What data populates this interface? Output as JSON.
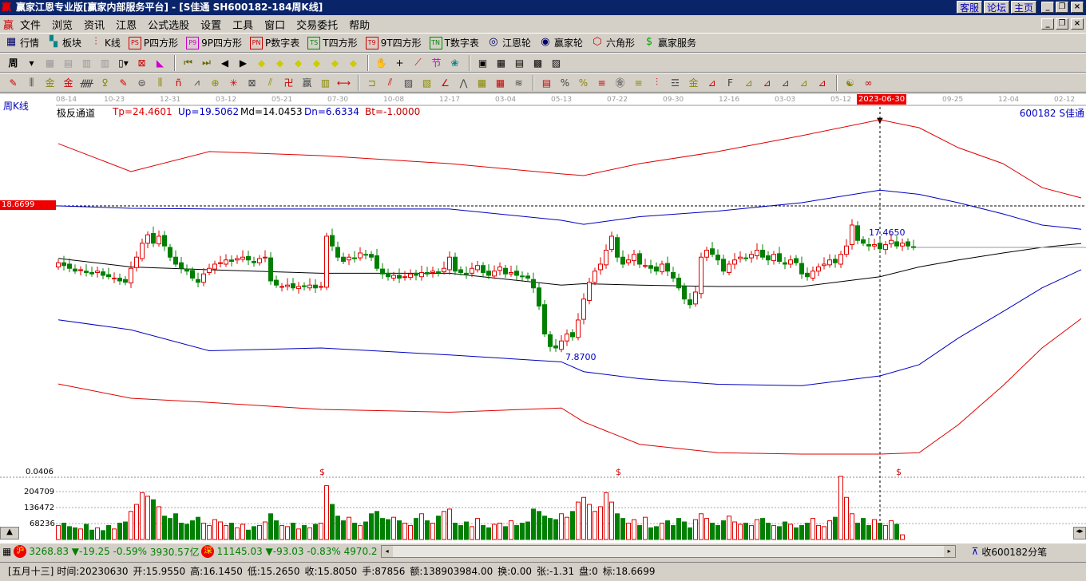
{
  "window": {
    "title": "赢家江恩专业版[赢家内部服务平台] - [S佳通  SH600182-184周K线]",
    "links": [
      "客服",
      "论坛",
      "主页"
    ]
  },
  "menu": [
    "文件",
    "浏览",
    "资讯",
    "江恩",
    "公式选股",
    "设置",
    "工具",
    "窗口",
    "交易委托",
    "帮助"
  ],
  "toolbar1": [
    {
      "icon": "grid-icon",
      "label": "行情"
    },
    {
      "icon": "blocks-icon",
      "label": "板块"
    },
    {
      "icon": "kline-icon",
      "label": "K线"
    },
    {
      "icon": "PS",
      "label": "P四方形"
    },
    {
      "icon": "P9",
      "label": "9P四方形"
    },
    {
      "icon": "PN",
      "label": "P数字表"
    },
    {
      "icon": "TS",
      "label": "T四方形"
    },
    {
      "icon": "T9",
      "label": "9T四方形"
    },
    {
      "icon": "TN",
      "label": "T数字表"
    },
    {
      "icon": "wheel-icon",
      "label": "江恩轮"
    },
    {
      "icon": "wheel2-icon",
      "label": "赢家轮"
    },
    {
      "icon": "hexagon-icon",
      "label": "六角形"
    },
    {
      "icon": "dollar-icon",
      "label": "赢家服务"
    }
  ],
  "toolbar2": {
    "period": "周"
  },
  "chart": {
    "period_label": "周K线",
    "indicator": "极反通道",
    "params": [
      {
        "label": "Tp=24.4601",
        "color": "#e00000"
      },
      {
        "label": "Up=19.5062",
        "color": "#0000c0"
      },
      {
        "label": "Md=14.0453",
        "color": "#000000"
      },
      {
        "label": "Dn=6.6334",
        "color": "#0000c0"
      },
      {
        "label": "Bt=-1.0000",
        "color": "#c00000"
      }
    ],
    "stock": "600182 S佳通",
    "date_ticks": [
      "08-14",
      "10-23",
      "12-31",
      "03-12",
      "05-21",
      "07-30",
      "10-08",
      "12-17",
      "03-04",
      "05-13",
      "07-22",
      "09-30",
      "12-16",
      "03-03",
      "05-12",
      "09-25",
      "12-04",
      "02-12"
    ],
    "cursor_date": "2023-06-30",
    "price_marker": "18.6699",
    "high_label": "17.4650",
    "low_label": "7.8700",
    "vol_axis": [
      "204709",
      "136472",
      "68236"
    ],
    "indicator_value": "0.0406",
    "dollar_mark": "$"
  },
  "chart_data": {
    "type": "candlestick",
    "closes": [
      14.6,
      14.4,
      14.2,
      14.0,
      14.1,
      13.9,
      13.8,
      14.0,
      13.7,
      13.6,
      13.5,
      13.3,
      13.2,
      14.2,
      15.0,
      16.0,
      16.6,
      16.0,
      16.5,
      15.8,
      15.0,
      14.5,
      14.2,
      14.0,
      13.5,
      13.2,
      13.8,
      14.2,
      14.5,
      14.6,
      14.8,
      14.7,
      14.9,
      15.0,
      14.8,
      14.6,
      14.9,
      15.0,
      13.3,
      13.0,
      12.9,
      13.0,
      12.8,
      12.9,
      12.9,
      13.0,
      12.8,
      12.9,
      16.5,
      15.8,
      15.0,
      14.7,
      15.0,
      14.9,
      15.3,
      15.2,
      15.0,
      14.2,
      13.8,
      13.6,
      13.7,
      13.5,
      13.6,
      13.8,
      13.7,
      13.9,
      13.8,
      14.0,
      13.9,
      14.2,
      15.0,
      14.0,
      13.9,
      13.8,
      14.2,
      14.4,
      13.9,
      13.7,
      14.0,
      14.3,
      13.8,
      13.9,
      13.7,
      13.6,
      13.5,
      12.8,
      11.5,
      9.5,
      8.6,
      8.5,
      9.0,
      9.5,
      9.3,
      10.5,
      12.0,
      13.2,
      14.0,
      14.5,
      15.5,
      16.5,
      15.0,
      14.5,
      14.8,
      15.2,
      14.5,
      14.4,
      14.2,
      14.0,
      14.5,
      14.0,
      13.5,
      12.8,
      12.0,
      11.6,
      12.5,
      15.0,
      15.5,
      15.2,
      14.8,
      14.0,
      14.5,
      14.8,
      15.0,
      14.9,
      15.2,
      15.5,
      15.0,
      14.8,
      15.2,
      14.7,
      14.5,
      14.8,
      14.6,
      13.8,
      13.6,
      14.0,
      14.3,
      14.5,
      14.8,
      14.6,
      15.2,
      15.8,
      17.3,
      16.2,
      16.0,
      15.8,
      15.9,
      15.6,
      15.9,
      16.2,
      15.8,
      16.0,
      15.8,
      15.7
    ],
    "volumes": [
      60000,
      70000,
      55000,
      50000,
      45000,
      65000,
      40000,
      50000,
      38000,
      60000,
      45000,
      70000,
      75000,
      120000,
      150000,
      200000,
      185000,
      170000,
      140000,
      100000,
      90000,
      110000,
      70000,
      65000,
      80000,
      95000,
      70000,
      60000,
      85000,
      75000,
      60000,
      70000,
      50000,
      65000,
      40000,
      55000,
      60000,
      75000,
      110000,
      80000,
      60000,
      55000,
      70000,
      45000,
      60000,
      50000,
      65000,
      70000,
      230000,
      150000,
      100000,
      80000,
      95000,
      70000,
      60000,
      75000,
      110000,
      120000,
      90000,
      85000,
      95000,
      80000,
      70000,
      60000,
      90000,
      110000,
      80000,
      70000,
      100000,
      120000,
      130000,
      70000,
      60000,
      75000,
      55000,
      90000,
      60000,
      50000,
      65000,
      70000,
      55000,
      80000,
      60000,
      70000,
      75000,
      130000,
      120000,
      100000,
      90000,
      85000,
      110000,
      95000,
      120000,
      160000,
      180000,
      150000,
      120000,
      140000,
      200000,
      160000,
      110000,
      90000,
      70000,
      85000,
      60000,
      95000,
      50000,
      55000,
      70000,
      80000,
      60000,
      90000,
      75000,
      50000,
      85000,
      110000,
      90000,
      70000,
      60000,
      80000,
      100000,
      75000,
      65000,
      70000,
      60000,
      85000,
      90000,
      70000,
      60000,
      55000,
      75000,
      65000,
      50000,
      60000,
      70000,
      90000,
      60000,
      55000,
      80000,
      95000,
      270000,
      180000,
      110000,
      70000,
      90000,
      60000,
      85000,
      70000,
      60000,
      80000,
      65000,
      20000
    ],
    "bands": {
      "index": [
        0,
        13,
        27,
        47,
        70,
        90,
        94,
        104,
        118,
        133,
        147,
        154,
        161,
        169,
        176,
        183
      ],
      "tp": [
        23.13,
        21.13,
        22.56,
        22.27,
        21.7,
        20.96,
        20.84,
        21.7,
        22.56,
        23.7,
        24.84,
        24.27,
        22.84,
        21.7,
        19.98,
        19.24
      ],
      "up": [
        18.67,
        18.5,
        18.45,
        18.45,
        18.45,
        17.64,
        17.35,
        17.9,
        18.3,
        18.9,
        19.8,
        19.5,
        18.9,
        18.1,
        17.3,
        17.0
      ],
      "md": [
        14.91,
        14.3,
        14.1,
        13.85,
        13.85,
        13.0,
        13.1,
        13.0,
        12.9,
        12.9,
        13.6,
        14.3,
        14.8,
        15.3,
        15.7,
        15.98
      ],
      "dn": [
        10.51,
        9.8,
        8.3,
        8.5,
        8.0,
        7.5,
        6.8,
        6.3,
        5.9,
        5.8,
        6.5,
        7.3,
        9.2,
        11.1,
        12.8,
        14.1
      ],
      "bt": [
        5.92,
        4.9,
        4.6,
        4.1,
        3.9,
        4.2,
        3.2,
        1.6,
        1.0,
        0.9,
        0.9,
        1.0,
        3.0,
        5.8,
        8.5,
        10.6
      ]
    }
  },
  "status": {
    "sh_value": "3268.83",
    "sh_change": "▼-19.25",
    "sh_pct": "-0.59%",
    "sh_amount": "3930.57亿",
    "sz_value": "11145.03",
    "sz_change": "▼-93.03",
    "sz_pct": "-0.83%",
    "sz_amount": "4970.2",
    "sh_badge": "沪",
    "sz_badge": "深",
    "right_text": "收600182分笔"
  },
  "info": {
    "lunar": "[五月十三]",
    "fields": [
      "时间:20230630",
      "开:15.9550",
      "高:16.1450",
      "低:15.2650",
      "收:15.8050",
      "手:87856",
      "额:138903984.00",
      "换:0.00",
      "张:-1.31",
      "盘:0",
      "标:18.6699"
    ]
  }
}
